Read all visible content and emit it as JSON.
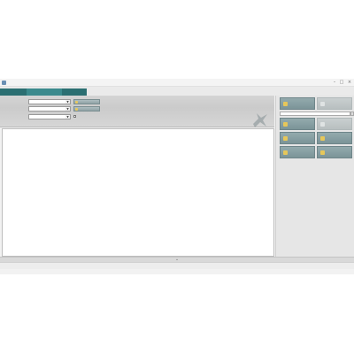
{
  "window": {
    "title": "",
    "minimize_glyph": "–",
    "maximize_glyph": "□",
    "close_glyph": "×"
  },
  "tabs": [
    {
      "label": "",
      "active": false
    },
    {
      "label": "",
      "active": true
    },
    {
      "label": "",
      "active": false
    }
  ],
  "controls": {
    "row1": {
      "label": "",
      "value": "",
      "button": ""
    },
    "row2": {
      "label": "",
      "value": "",
      "button": ""
    },
    "row3": {
      "label": "",
      "value": "",
      "checkbox_label": ""
    }
  },
  "log": {
    "header": "",
    "lines": [
      ""
    ]
  },
  "right_panel": {
    "progress_text": "",
    "buttons": [
      {
        "label": "",
        "enabled": true
      },
      {
        "label": "",
        "enabled": false
      },
      {
        "label": "",
        "enabled": true
      },
      {
        "label": "",
        "enabled": false
      },
      {
        "label": "",
        "enabled": true
      },
      {
        "label": "",
        "enabled": true
      },
      {
        "label": "",
        "enabled": true
      },
      {
        "label": "",
        "enabled": true
      }
    ]
  },
  "status": {
    "top_left": "",
    "bottom_left": "",
    "bottom_right": ""
  },
  "colors": {
    "tab_strip": "#2b6f72",
    "button_fill": "#7b9498",
    "icon_gold": "#e6c75a"
  }
}
